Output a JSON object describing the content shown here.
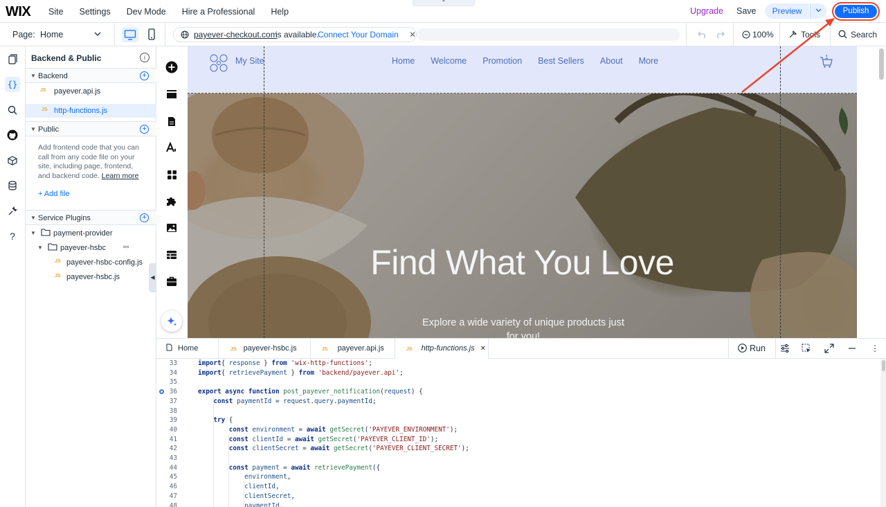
{
  "app": {
    "logo": "WIX"
  },
  "topbar": {
    "menu": [
      "Site",
      "Settings",
      "Dev Mode",
      "Hire a Professional",
      "Help"
    ],
    "upgrade": "Upgrade",
    "save": "Save",
    "preview": "Preview",
    "publish": "Publish"
  },
  "subbar": {
    "page_label": "Page:",
    "page_value": "Home",
    "domain": "payever-checkout.com",
    "available": "is available.",
    "connect": "Connect Your Domain",
    "zoom": "100%",
    "tools": "Tools",
    "search": "Search"
  },
  "code_panel": {
    "title": "Backend & Public",
    "backend_label": "Backend",
    "backend_files": [
      "payever.api.js",
      "http-functions.js"
    ],
    "public_label": "Public",
    "public_text": "Add frontend code that you can call from any code file on your site, including page, frontend, and backend code.",
    "learn_more": "Learn more",
    "add_file": "+ Add file",
    "service_label": "Service Plugins",
    "folder_root": "payment-provider",
    "folder_sub": "payever-hsbc",
    "service_files": [
      "payever-hsbc-config.js",
      "payever-hsbc.js"
    ]
  },
  "site": {
    "name": "My Site",
    "nav": [
      "Home",
      "Welcome",
      "Promotion",
      "Best Sellers",
      "About",
      "More"
    ],
    "cart_count": "1",
    "hero_title": "Find What You Love",
    "hero_sub": "Explore a wide variety of unique products just for you!"
  },
  "editor": {
    "tabs": [
      {
        "name": "Home",
        "icon": "page-icon"
      },
      {
        "name": "payever-hsbc.js",
        "icon": "js-icon"
      },
      {
        "name": "payever.api.js",
        "icon": "js-icon"
      },
      {
        "name": "http-functions.js",
        "icon": "js-icon",
        "active": true
      }
    ],
    "run": "Run",
    "line_numbers": [
      "33",
      "34",
      "35",
      "36",
      "37",
      "38",
      "39",
      "40",
      "41",
      "42",
      "43",
      "44",
      "45",
      "46",
      "47",
      "48"
    ],
    "code": [
      [
        [
          "kw",
          "import"
        ],
        [
          "",
          "{ "
        ],
        [
          "va",
          "response"
        ],
        [
          "",
          " } "
        ],
        [
          "kw",
          "from"
        ],
        [
          "",
          " "
        ],
        [
          "st",
          "'wix-http-functions'"
        ],
        [
          "",
          ";"
        ]
      ],
      [
        [
          "kw",
          "import"
        ],
        [
          "",
          "{ "
        ],
        [
          "va",
          "retrievePayment"
        ],
        [
          "",
          " } "
        ],
        [
          "kw",
          "from"
        ],
        [
          "",
          " "
        ],
        [
          "st",
          "'backend/payever.api'"
        ],
        [
          "",
          ";"
        ]
      ],
      [],
      [
        [
          "kw",
          "export async function "
        ],
        [
          "fn",
          "post_payever_notification"
        ],
        [
          "",
          "("
        ],
        [
          "va",
          "request"
        ],
        [
          "",
          ") {"
        ]
      ],
      [
        [
          "",
          "    "
        ],
        [
          "kw",
          "const "
        ],
        [
          "va",
          "paymentId"
        ],
        [
          "",
          " = "
        ],
        [
          "va",
          "request"
        ],
        [
          "",
          "."
        ],
        [
          "va",
          "query"
        ],
        [
          "",
          "."
        ],
        [
          "va",
          "paymentId"
        ],
        [
          "",
          ";"
        ]
      ],
      [],
      [
        [
          "",
          "    "
        ],
        [
          "kw",
          "try"
        ],
        [
          "",
          " {"
        ]
      ],
      [
        [
          "",
          "        "
        ],
        [
          "kw",
          "const "
        ],
        [
          "va",
          "environment"
        ],
        [
          "",
          " = "
        ],
        [
          "kw",
          "await "
        ],
        [
          "fn",
          "getSecret"
        ],
        [
          "",
          "("
        ],
        [
          "st",
          "'PAYEVER_ENVIRONMENT'"
        ],
        [
          "",
          ");"
        ]
      ],
      [
        [
          "",
          "        "
        ],
        [
          "kw",
          "const "
        ],
        [
          "va",
          "clientId"
        ],
        [
          "",
          " = "
        ],
        [
          "kw",
          "await "
        ],
        [
          "fn",
          "getSecret"
        ],
        [
          "",
          "("
        ],
        [
          "st",
          "'PAYEVER_CLIENT_ID'"
        ],
        [
          "",
          ");"
        ]
      ],
      [
        [
          "",
          "        "
        ],
        [
          "kw",
          "const "
        ],
        [
          "va",
          "clientSecret"
        ],
        [
          "",
          " = "
        ],
        [
          "kw",
          "await "
        ],
        [
          "fn",
          "getSecret"
        ],
        [
          "",
          "("
        ],
        [
          "st",
          "'PAYEVER_CLIENT_SECRET'"
        ],
        [
          "",
          ");"
        ]
      ],
      [],
      [
        [
          "",
          "        "
        ],
        [
          "kw",
          "const "
        ],
        [
          "va",
          "payment"
        ],
        [
          "",
          " = "
        ],
        [
          "kw",
          "await "
        ],
        [
          "fn",
          "retrievePayment"
        ],
        [
          "",
          "({"
        ]
      ],
      [
        [
          "",
          "            "
        ],
        [
          "va",
          "environment"
        ],
        [
          "",
          ","
        ]
      ],
      [
        [
          "",
          "            "
        ],
        [
          "va",
          "clientId"
        ],
        [
          "",
          ","
        ]
      ],
      [
        [
          "",
          "            "
        ],
        [
          "va",
          "clientSecret"
        ],
        [
          "",
          ","
        ]
      ],
      [
        [
          "",
          "            "
        ],
        [
          "va",
          "paymentId"
        ],
        [
          "",
          ","
        ]
      ]
    ]
  },
  "colors": {
    "accent": "#116dff",
    "upgrade": "#9a27d5",
    "annotation": "#e8452c"
  }
}
